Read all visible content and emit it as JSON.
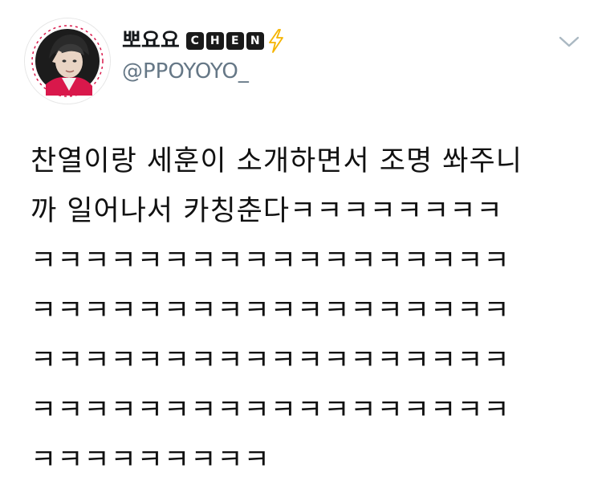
{
  "user": {
    "display_name": "뽀요요",
    "badge_letters": [
      "C",
      "H",
      "E",
      "N"
    ],
    "handle": "@PPOYOYO_",
    "lightning_color": "#f5b400"
  },
  "tweet": {
    "lines": [
      "찬열이랑 세훈이 소개하면서 조명 쏴주니",
      "까 일어나서 카칭춘다ㅋㅋㅋㅋㅋㅋㅋㅋ",
      "ㅋㅋㅋㅋㅋㅋㅋㅋㅋㅋㅋㅋㅋㅋㅋㅋㅋㅋ",
      "ㅋㅋㅋㅋㅋㅋㅋㅋㅋㅋㅋㅋㅋㅋㅋㅋㅋㅋ",
      "ㅋㅋㅋㅋㅋㅋㅋㅋㅋㅋㅋㅋㅋㅋㅋㅋㅋㅋ",
      "ㅋㅋㅋㅋㅋㅋㅋㅋㅋㅋㅋㅋㅋㅋㅋㅋㅋㅋ",
      "ㅋㅋㅋㅋㅋㅋㅋㅋㅋ"
    ]
  },
  "icons": {
    "menu": "chevron-down-icon",
    "badge_extra": "lightning-icon",
    "avatar": "avatar"
  },
  "colors": {
    "text": "#111111",
    "secondary": "#657786",
    "chevron": "#aab8c2",
    "badge_bg": "#1a1a1a"
  }
}
